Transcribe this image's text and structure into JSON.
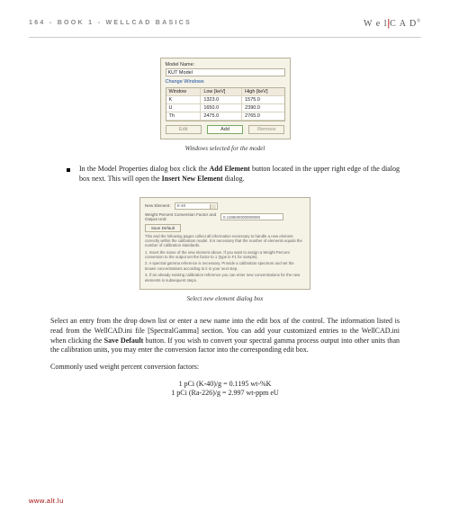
{
  "header": {
    "left": "164 - BOOK 1 - WELLCAD BASICS",
    "brand_pre": "W e l",
    "brand_bar": "|",
    "brand_post": "C A D",
    "brand_sup": "®"
  },
  "fig1": {
    "model_name_label": "Model Name:",
    "model_name_value": "KUT Model",
    "change_link": "Change Windows",
    "cols": {
      "c1": "Window",
      "c2": "Low [keV]",
      "c3": "High [keV]"
    },
    "rows": [
      {
        "w": "K",
        "lo": "1323.0",
        "hi": "1575.0"
      },
      {
        "w": "U",
        "lo": "1650.0",
        "hi": "2390.0"
      },
      {
        "w": "Th",
        "lo": "2475.0",
        "hi": "2765.0"
      }
    ],
    "btn_edit": "Edit",
    "btn_add": "Add",
    "btn_remove": "Remove",
    "caption": "Windows selected for the model"
  },
  "bullet": {
    "text_a": "In the Model Properties dialog box click the ",
    "bold_a": "Add Element",
    "text_b": " button located in the upper right edge of the dialog box next. This will open the ",
    "bold_b": "Insert New Element",
    "text_c": " dialog."
  },
  "fig2": {
    "new_element_label": "New Element:",
    "new_element_value": "K-40",
    "factor_label": "Weight Percent Conversion Factor and Output Unit:",
    "factor_value": "0.119500000000000",
    "save_default": "Save Default",
    "p0": "This and the following pages collect all information necessary to handle a new element correctly within the calibration model. It is necessary that the number of elements equals the number of calibration standards.",
    "p1": "1. Insert the name of the new element above. If you want to assign a Weight Percent conversion to the output set the factor to 1 (type in F1 for sample).",
    "p2": "2. A spectral gamma reference is necessary. Provide a calibration spectrum and set the known concentrations according to it in your next step.",
    "p3": "3. If an already existing calibration reference you can enter new concentrations for the new elements in subsequent steps.",
    "caption": "Select new element dialog box"
  },
  "para1": {
    "a": "Select an entry from the drop down list or enter a new name into the edit box of the control. The information listed is read from the WellCAD.ini file [SpectralGamma] section. You can add your customized entries to the WellCAD.ini when clicking the ",
    "b": "Save Default",
    "c": " button. If you wish to convert your spectral gamma process output into other units than the calibration units, you may enter the conversion factor into the corresponding edit box."
  },
  "para2": "Commonly used weight percent conversion factors:",
  "conv1": "1 pCi (K-40)/g = 0.1195 wt-%K",
  "conv2": "1 pCi (Ra-226)/g = 2.997 wt-ppm eU",
  "footer": "www.alt.lu"
}
